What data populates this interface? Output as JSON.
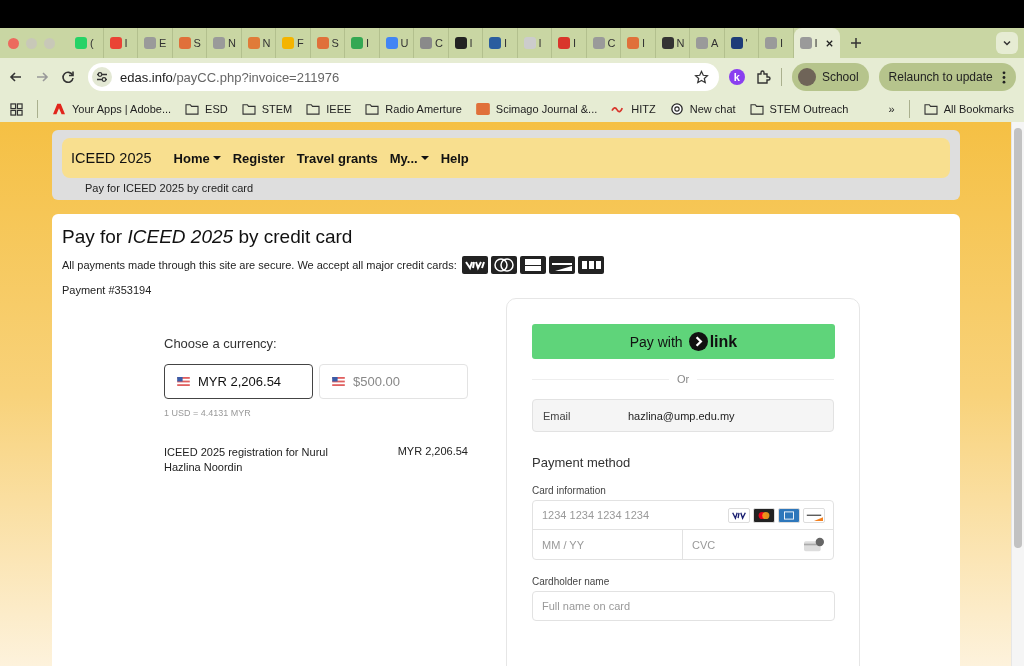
{
  "browser": {
    "tabs": [
      {
        "title": "(",
        "color": "#25d366",
        "selected": false
      },
      {
        "title": "I",
        "color": "#ea4335",
        "selected": false
      },
      {
        "title": "E",
        "color": "#9a9a9a",
        "selected": false
      },
      {
        "title": "S",
        "color": "#e0703a",
        "selected": false
      },
      {
        "title": "N",
        "color": "#9a9a9a",
        "selected": false
      },
      {
        "title": "N",
        "color": "#e07b39",
        "selected": false
      },
      {
        "title": "F",
        "color": "#f4b400",
        "selected": false
      },
      {
        "title": "S",
        "color": "#e0703a",
        "selected": false
      },
      {
        "title": "I",
        "color": "#34a853",
        "selected": false
      },
      {
        "title": "U",
        "color": "#4285f4",
        "selected": false
      },
      {
        "title": "C",
        "color": "#8a8a8a",
        "selected": false
      },
      {
        "title": "I",
        "color": "#222222",
        "selected": false
      },
      {
        "title": "I",
        "color": "#2a5d9f",
        "selected": false
      },
      {
        "title": "I",
        "color": "#cccccc",
        "selected": false
      },
      {
        "title": "I",
        "color": "#d9352b",
        "selected": false
      },
      {
        "title": "C",
        "color": "#9a9a9a",
        "selected": false
      },
      {
        "title": "I",
        "color": "#e0703a",
        "selected": false
      },
      {
        "title": "N",
        "color": "#333333",
        "selected": false
      },
      {
        "title": "A",
        "color": "#9a9a9a",
        "selected": false
      },
      {
        "title": "'",
        "color": "#1d3c78",
        "selected": false
      },
      {
        "title": "I",
        "color": "#9a9a9a",
        "selected": false
      },
      {
        "title": "I",
        "color": "#9a9a9a",
        "selected": true
      }
    ],
    "address": {
      "host": "edas.info",
      "path": "/payCC.php?invoice=211976"
    },
    "extension_badge": "k",
    "profile": "School",
    "relaunch": "Relaunch to update",
    "bookmarks": [
      {
        "label": "Your Apps | Adobe...",
        "kind": "adobe"
      },
      {
        "label": "ESD",
        "kind": "folder"
      },
      {
        "label": "STEM",
        "kind": "folder"
      },
      {
        "label": "IEEE",
        "kind": "folder"
      },
      {
        "label": "Radio Amerture",
        "kind": "folder"
      },
      {
        "label": "Scimago Journal &...",
        "kind": "sjr"
      },
      {
        "label": "HITZ",
        "kind": "hitz"
      },
      {
        "label": "New chat",
        "kind": "chat"
      },
      {
        "label": "STEM Outreach",
        "kind": "folder"
      }
    ],
    "overflow": "»",
    "all_bookmarks": "All Bookmarks"
  },
  "site": {
    "brand": "ICEED 2025",
    "nav": [
      {
        "label": "Home",
        "dropdown": true
      },
      {
        "label": "Register",
        "dropdown": false
      },
      {
        "label": "Travel grants",
        "dropdown": false
      },
      {
        "label": "My...",
        "dropdown": true
      },
      {
        "label": "Help",
        "dropdown": false
      }
    ],
    "breadcrumb": "Pay for ICEED 2025 by credit card"
  },
  "page": {
    "title": "Pay for *ICEED 2025* by credit card",
    "secure_note": "All payments made through this site are secure. We accept all major credit cards:",
    "cards": [
      {
        "kind": "visa"
      },
      {
        "kind": "mastercard"
      },
      {
        "kind": "amex"
      },
      {
        "kind": "discover"
      },
      {
        "kind": "jcb"
      }
    ],
    "payment_no": "Payment #353194",
    "currency_label": "Choose a currency:",
    "currencies": [
      {
        "amount": "MYR 2,206.54",
        "selected": true
      },
      {
        "amount": "$500.00",
        "selected": false
      }
    ],
    "rate": "1 USD = 4.4131 MYR",
    "line_item": {
      "description": "ICEED 2025 registration for Nurul Hazlina Noordin",
      "amount": "MYR 2,206.54"
    }
  },
  "checkout": {
    "pay_with": "Pay with",
    "link_word": "link",
    "or": "Or",
    "email_label": "Email",
    "email": "hazlina@ump.edu.my",
    "payment_method": "Payment method",
    "card_info": "Card information",
    "card_placeholder": "1234 1234 1234 1234",
    "card_brands": [
      {
        "kind": "visa"
      },
      {
        "kind": "mastercard"
      },
      {
        "kind": "amex"
      },
      {
        "kind": "discover"
      }
    ],
    "expiry_placeholder": "MM / YY",
    "cvc_placeholder": "CVC",
    "cardholder_label": "Cardholder name",
    "cardholder_placeholder": "Full name on card"
  }
}
